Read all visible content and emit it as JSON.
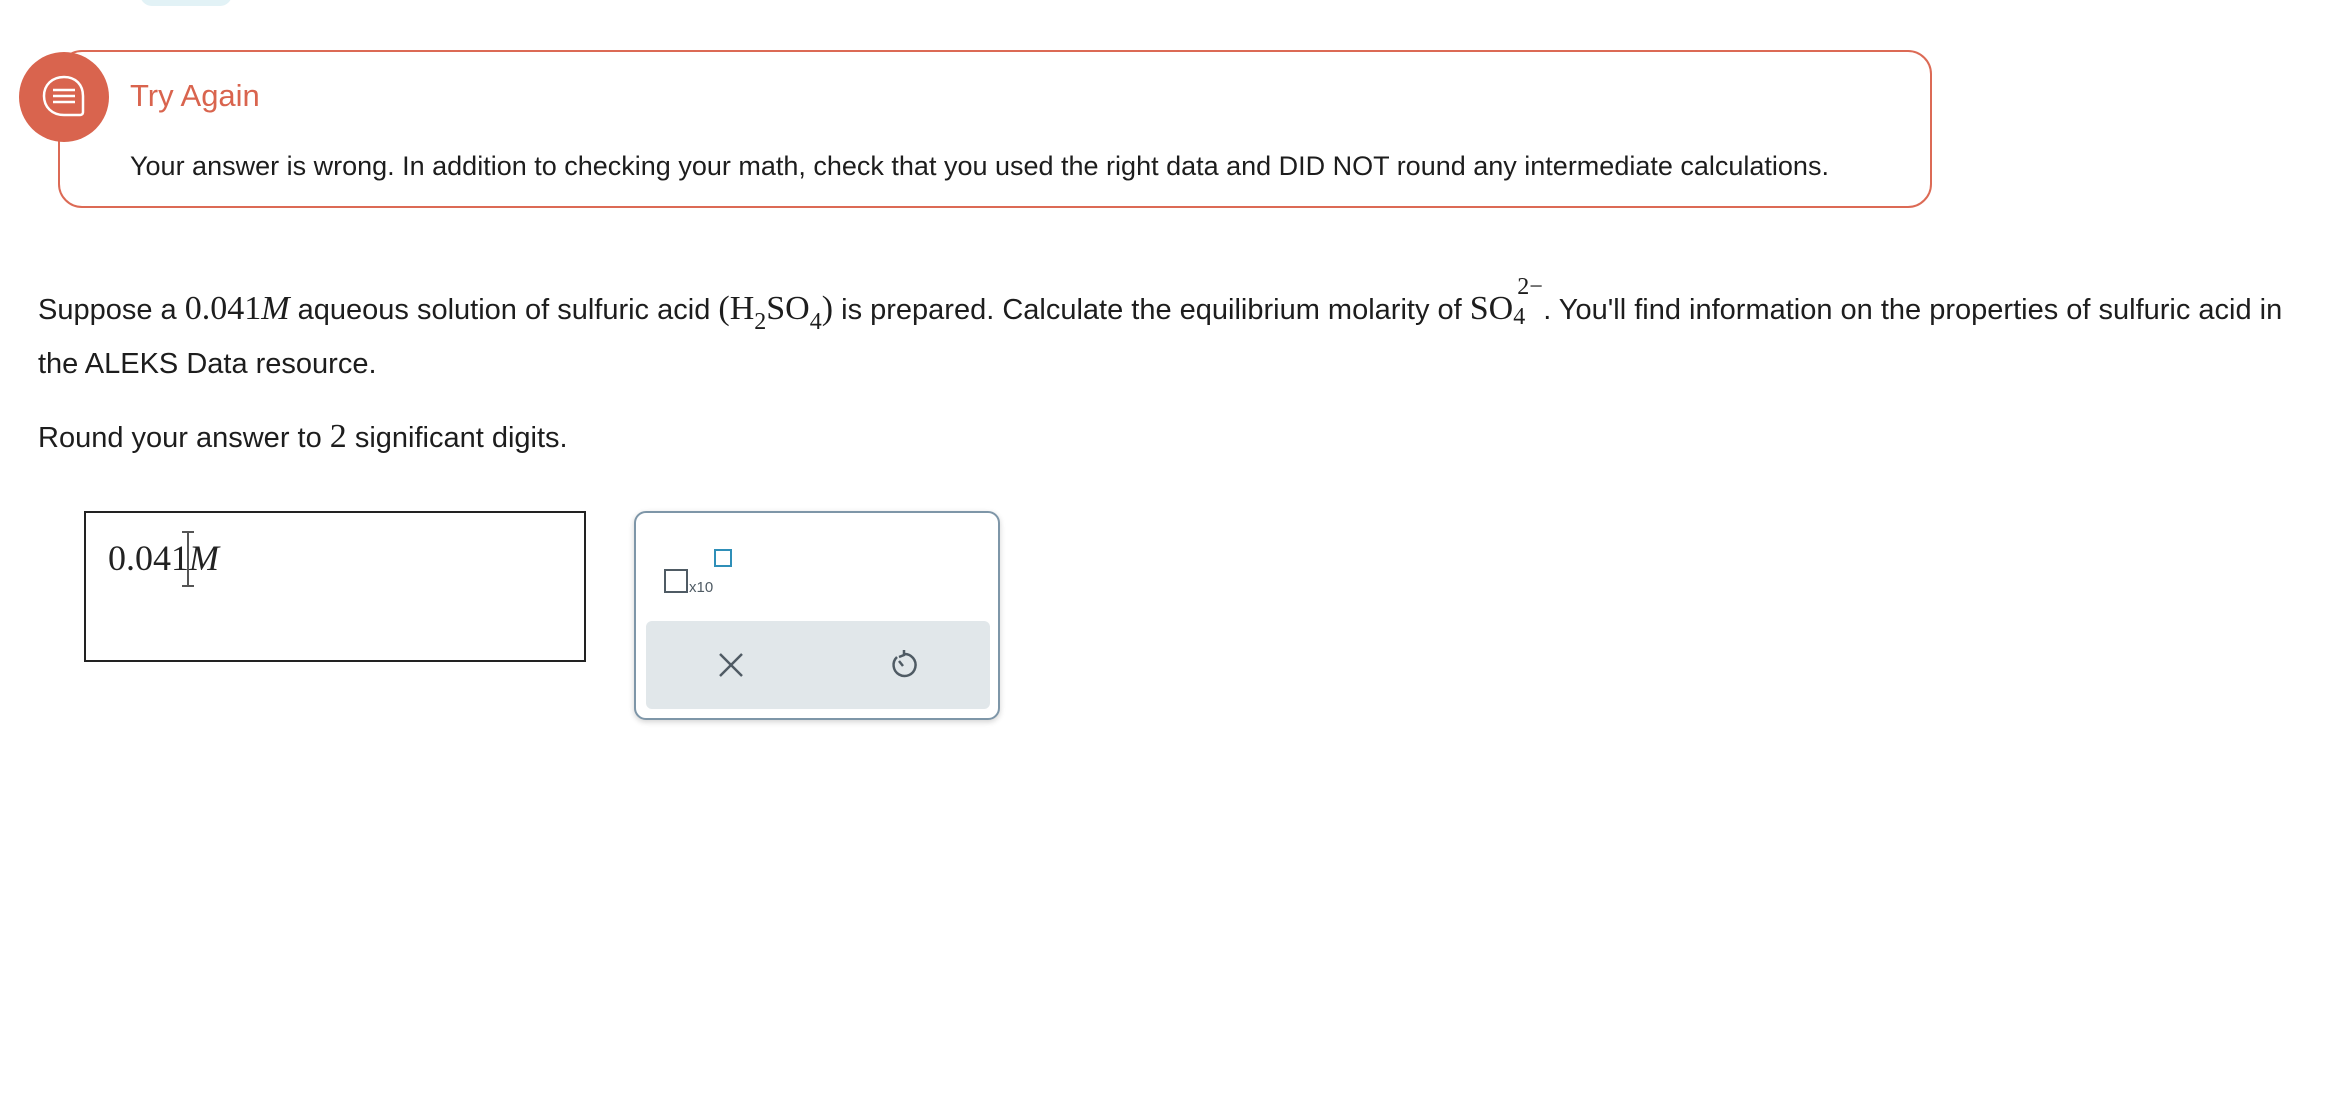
{
  "feedback": {
    "title": "Try Again",
    "message": "Your answer is wrong. In addition to checking your math, check that you used the right data and DID NOT round any intermediate calculations.",
    "accent_color": "#d9644e",
    "icon": "chat-bubble-icon"
  },
  "question": {
    "part1": "Suppose a ",
    "concentration": "0.041",
    "unit": "M",
    "part2": " aqueous solution of sulfuric acid ",
    "formula_open": "(H",
    "h_sub": "2",
    "so": "SO",
    "o4_sub": "4",
    "formula_close": ")",
    "part3": " is prepared. Calculate the equilibrium molarity of ",
    "ion_base": "SO",
    "ion_sub": "4",
    "ion_charge": "2−",
    "part4": ". You'll find information on the properties of sulfuric acid in the ALEKS Data resource."
  },
  "rounding": {
    "prefix": "Round your answer to ",
    "digits": "2",
    "suffix": " significant digits."
  },
  "answer": {
    "value": "0.041",
    "unit": "M"
  },
  "tools": {
    "x10_label": "x10",
    "clear_icon": "close-icon",
    "undo_icon": "undo-icon"
  }
}
